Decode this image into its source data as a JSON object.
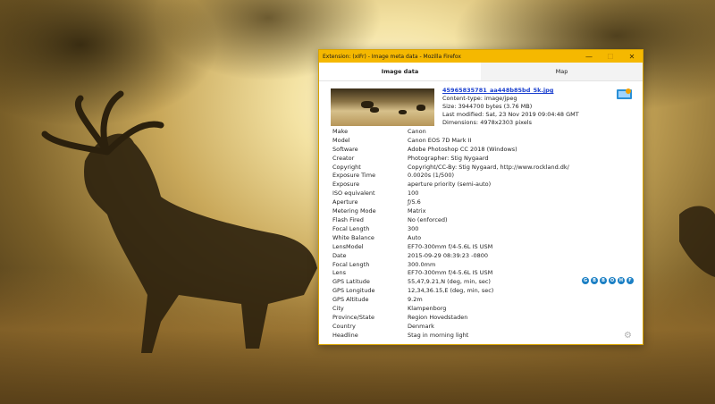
{
  "window": {
    "title": "Extension: (xIFr) - Image meta data - Mozilla Firefox",
    "minimize": "—",
    "maximize": "☐",
    "close": "✕"
  },
  "tabs": [
    {
      "label": "Image data"
    },
    {
      "label": "Map"
    }
  ],
  "file": {
    "name": "45965835781_aa448b85bd_5k.jpg",
    "content_type": "Content-type: image/jpeg",
    "size": "Size: 3944700 bytes (3.76 MB)",
    "modified": "Last modified: Sat, 23 Nov 2019 09:04:48 GMT",
    "dimensions": "Dimensions: 4978x2303 pixels"
  },
  "meta": [
    {
      "key": "Make",
      "value": "Canon"
    },
    {
      "key": "Model",
      "value": "Canon EOS 7D Mark II"
    },
    {
      "key": "Software",
      "value": "Adobe Photoshop CC 2018 (Windows)"
    },
    {
      "key": "Creator",
      "value": "Photographer: Stig Nygaard"
    },
    {
      "key": "Copyright",
      "value": "Copyright/CC-By: Stig Nygaard, http://www.rockland.dk/"
    },
    {
      "key": "Exposure Time",
      "value": "0.0020s (1/500)"
    },
    {
      "key": "Exposure",
      "value": "aperture priority (semi-auto)"
    },
    {
      "key": "ISO equivalent",
      "value": "100"
    },
    {
      "key": "Aperture",
      "value": "ƒ/5.6"
    },
    {
      "key": "Metering Mode",
      "value": "Matrix"
    },
    {
      "key": "Flash Fired",
      "value": "No (enforced)"
    },
    {
      "key": "Focal Length",
      "value": "300"
    },
    {
      "key": "White Balance",
      "value": "Auto"
    },
    {
      "key": "LensModel",
      "value": "EF70-300mm f/4-5.6L IS USM"
    },
    {
      "key": "Date",
      "value": "2015-09-29 08:39:23 -0800"
    },
    {
      "key": "Focal Length",
      "value": "300.0mm"
    },
    {
      "key": "Lens",
      "value": "EF70-300mm f/4-5.6L IS USM"
    },
    {
      "key": "GPS Latitude",
      "value": "55,47,9.21,N (deg, min, sec)"
    },
    {
      "key": "GPS Longitude",
      "value": "12,34,36.15,E (deg, min, sec)"
    },
    {
      "key": "GPS Altitude",
      "value": "9.2m"
    },
    {
      "key": "City",
      "value": "Klampenborg"
    },
    {
      "key": "Province/State",
      "value": "Region Hovedstaden"
    },
    {
      "key": "Country",
      "value": "Denmark"
    },
    {
      "key": "Headline",
      "value": "Stag in morning light"
    }
  ],
  "map_links": [
    "G",
    "B",
    "B",
    "O",
    "H",
    "F"
  ],
  "colors": {
    "titlebar": "#f5b800",
    "link": "#1a3fcf",
    "map_icon": "#1b7fc4"
  }
}
